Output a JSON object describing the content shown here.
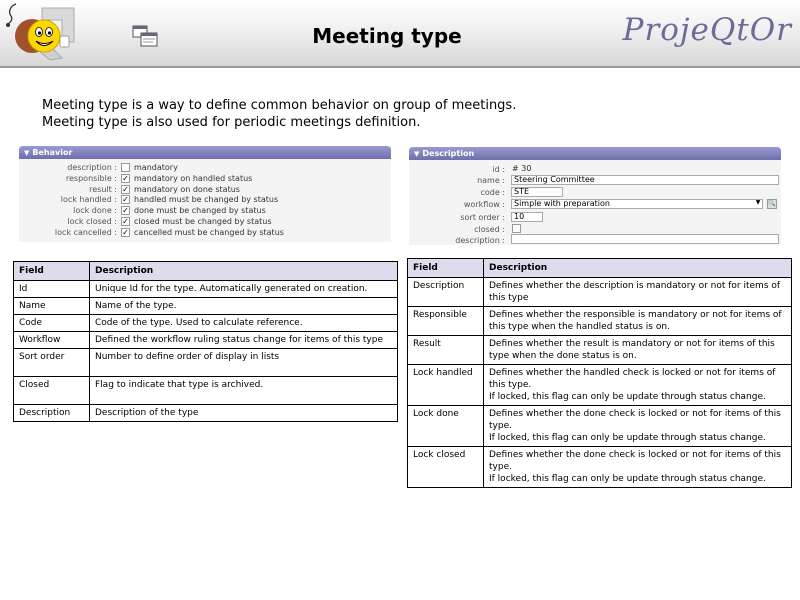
{
  "header": {
    "title": "Meeting type",
    "brand": "ProjeQtOr",
    "logo_icon": "smiley-mascot-logo-icon",
    "app_icon": "window-screens-icon"
  },
  "intro": {
    "line1": "Meeting type is a way to define common behavior on group of meetings.",
    "line2": "Meeting type is also used for periodic meetings definition."
  },
  "behavior_panel": {
    "title": "Behavior",
    "rows": [
      {
        "label": "description :",
        "checked": false,
        "text": "mandatory"
      },
      {
        "label": "responsible :",
        "checked": true,
        "text": "mandatory on handled status"
      },
      {
        "label": "result :",
        "checked": true,
        "text": "mandatory on done status"
      },
      {
        "label": "lock handled :",
        "checked": true,
        "text": "handled must be changed by status"
      },
      {
        "label": "lock done :",
        "checked": true,
        "text": "done must be changed by status"
      },
      {
        "label": "lock closed :",
        "checked": true,
        "text": "closed must be changed by status"
      },
      {
        "label": "lock cancelled :",
        "checked": true,
        "text": "cancelled must be changed by status"
      }
    ]
  },
  "description_panel": {
    "title": "Description",
    "id_label": "id :",
    "id_value": "# 30",
    "name_label": "name :",
    "name_value": "Steering Committee",
    "code_label": "code :",
    "code_value": "STE",
    "workflow_label": "workflow :",
    "workflow_value": "Simple with preparation",
    "sort_order_label": "sort order :",
    "sort_order_value": "10",
    "closed_label": "closed :",
    "description_label": "description :",
    "description_value": ""
  },
  "left_table": {
    "headers": [
      "Field",
      "Description"
    ],
    "rows": [
      [
        "Id",
        "Unique Id for the type. Automatically generated on creation."
      ],
      [
        "Name",
        "Name of the type."
      ],
      [
        "Code",
        "Code of the type. Used to calculate reference."
      ],
      [
        "Workflow",
        "Defined the workflow ruling status change for items of this type"
      ],
      [
        "Sort order",
        "Number to define order of display in lists"
      ],
      [
        "Closed",
        "Flag to indicate that type is archived."
      ],
      [
        "Description",
        "Description of the type"
      ]
    ]
  },
  "right_table": {
    "headers": [
      "Field",
      "Description"
    ],
    "rows": [
      {
        "field": "Description",
        "desc": "Defines whether the description is mandatory or not for items of this type",
        "note": ""
      },
      {
        "field": "Responsible",
        "desc": "Defines whether the responsible is mandatory or not for items of this type when the handled status is on.",
        "note": ""
      },
      {
        "field": "Result",
        "desc": "Defines whether the result is mandatory or not for items of this type when the done status is on.",
        "note": ""
      },
      {
        "field": "Lock handled",
        "desc": "Defines whether the handled check is locked or not for items of this type.",
        "note": "If locked, this flag can only be update through status change."
      },
      {
        "field": "Lock done",
        "desc": "Defines whether the done check is locked or not for items of this type.",
        "note": "If locked, this flag can only be update through status change."
      },
      {
        "field": "Lock closed",
        "desc": "Defines whether the done check is locked or not for items of this type.",
        "note": "If locked, this flag can only be update through status change."
      }
    ]
  }
}
